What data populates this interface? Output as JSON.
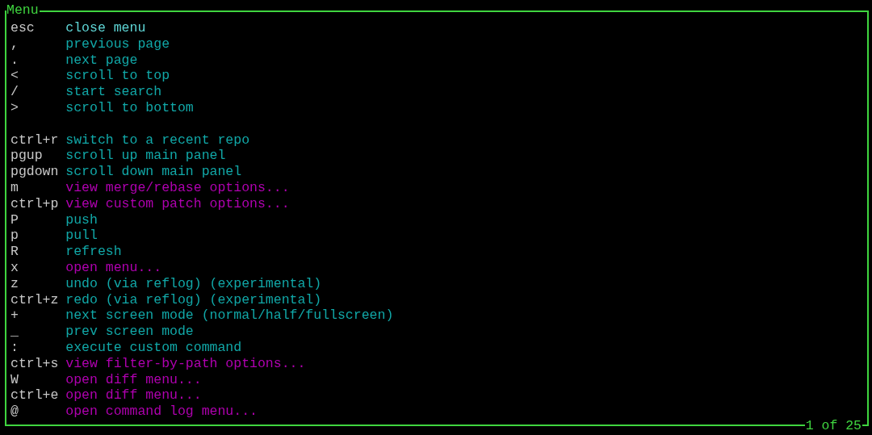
{
  "panel": {
    "title": "Menu",
    "footer": "1 of 25"
  },
  "sections": [
    {
      "items": [
        {
          "key": "esc",
          "description": "close menu",
          "kind": "action",
          "selected": true
        },
        {
          "key": ",",
          "description": "previous page",
          "kind": "action",
          "selected": false
        },
        {
          "key": ".",
          "description": "next page",
          "kind": "action",
          "selected": false
        },
        {
          "key": "<",
          "description": "scroll to top",
          "kind": "action",
          "selected": false
        },
        {
          "key": "/",
          "description": "start search",
          "kind": "action",
          "selected": false
        },
        {
          "key": ">",
          "description": "scroll to bottom",
          "kind": "action",
          "selected": false
        }
      ]
    },
    {
      "items": [
        {
          "key": "ctrl+r",
          "description": "switch to a recent repo",
          "kind": "action",
          "selected": false
        },
        {
          "key": "pgup",
          "description": "scroll up main panel",
          "kind": "action",
          "selected": false
        },
        {
          "key": "pgdown",
          "description": "scroll down main panel",
          "kind": "action",
          "selected": false
        },
        {
          "key": "m",
          "description": "view merge/rebase options...",
          "kind": "menu",
          "selected": false
        },
        {
          "key": "ctrl+p",
          "description": "view custom patch options...",
          "kind": "menu",
          "selected": false
        },
        {
          "key": "P",
          "description": "push",
          "kind": "action",
          "selected": false
        },
        {
          "key": "p",
          "description": "pull",
          "kind": "action",
          "selected": false
        },
        {
          "key": "R",
          "description": "refresh",
          "kind": "action",
          "selected": false
        },
        {
          "key": "x",
          "description": "open menu...",
          "kind": "menu",
          "selected": false
        },
        {
          "key": "z",
          "description": "undo (via reflog) (experimental)",
          "kind": "action",
          "selected": false
        },
        {
          "key": "ctrl+z",
          "description": "redo (via reflog) (experimental)",
          "kind": "action",
          "selected": false
        },
        {
          "key": "+",
          "description": "next screen mode (normal/half/fullscreen)",
          "kind": "action",
          "selected": false
        },
        {
          "key": "_",
          "description": "prev screen mode",
          "kind": "action",
          "selected": false
        },
        {
          "key": ":",
          "description": "execute custom command",
          "kind": "action",
          "selected": false
        },
        {
          "key": "ctrl+s",
          "description": "view filter-by-path options...",
          "kind": "menu",
          "selected": false
        },
        {
          "key": "W",
          "description": "open diff menu...",
          "kind": "menu",
          "selected": false
        },
        {
          "key": "ctrl+e",
          "description": "open diff menu...",
          "kind": "menu",
          "selected": false
        },
        {
          "key": "@",
          "description": "open command log menu...",
          "kind": "menu",
          "selected": false
        }
      ]
    }
  ]
}
